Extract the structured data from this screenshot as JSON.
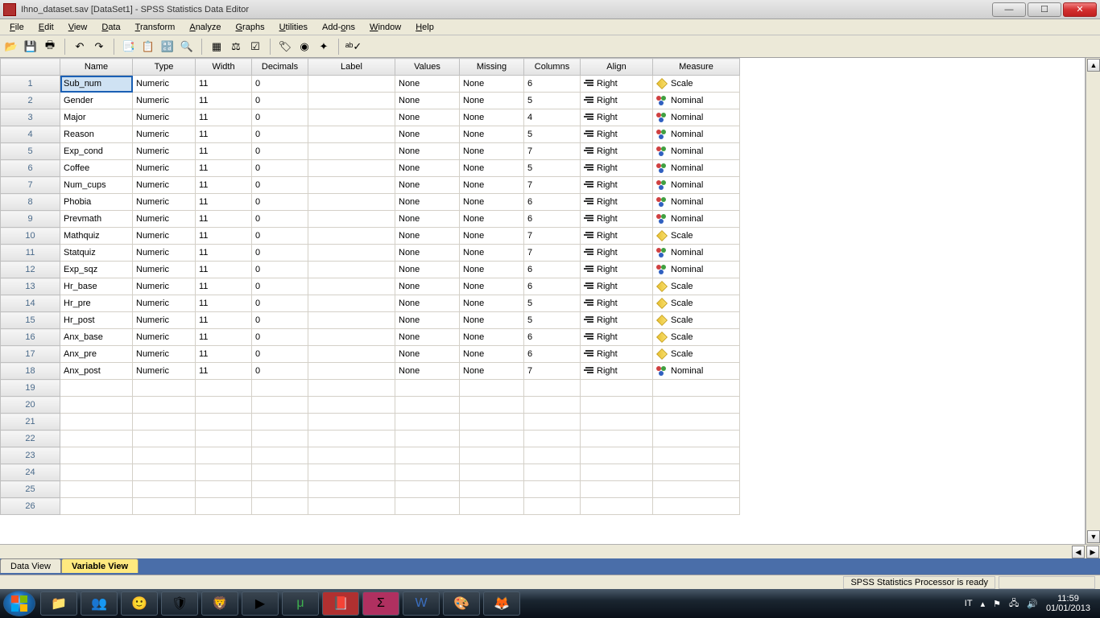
{
  "window": {
    "title": "Ihno_dataset.sav [DataSet1] - SPSS Statistics Data Editor"
  },
  "menus": [
    "File",
    "Edit",
    "View",
    "Data",
    "Transform",
    "Analyze",
    "Graphs",
    "Utilities",
    "Add-ons",
    "Window",
    "Help"
  ],
  "columns": [
    "Name",
    "Type",
    "Width",
    "Decimals",
    "Label",
    "Values",
    "Missing",
    "Columns",
    "Align",
    "Measure"
  ],
  "rows": [
    {
      "n": "1",
      "name": "Sub_num",
      "type": "Numeric",
      "width": "11",
      "dec": "0",
      "label": "",
      "values": "None",
      "missing": "None",
      "cols": "6",
      "align": "Right",
      "measure": "Scale"
    },
    {
      "n": "2",
      "name": "Gender",
      "type": "Numeric",
      "width": "11",
      "dec": "0",
      "label": "",
      "values": "None",
      "missing": "None",
      "cols": "5",
      "align": "Right",
      "measure": "Nominal"
    },
    {
      "n": "3",
      "name": "Major",
      "type": "Numeric",
      "width": "11",
      "dec": "0",
      "label": "",
      "values": "None",
      "missing": "None",
      "cols": "4",
      "align": "Right",
      "measure": "Nominal"
    },
    {
      "n": "4",
      "name": "Reason",
      "type": "Numeric",
      "width": "11",
      "dec": "0",
      "label": "",
      "values": "None",
      "missing": "None",
      "cols": "5",
      "align": "Right",
      "measure": "Nominal"
    },
    {
      "n": "5",
      "name": "Exp_cond",
      "type": "Numeric",
      "width": "11",
      "dec": "0",
      "label": "",
      "values": "None",
      "missing": "None",
      "cols": "7",
      "align": "Right",
      "measure": "Nominal"
    },
    {
      "n": "6",
      "name": "Coffee",
      "type": "Numeric",
      "width": "11",
      "dec": "0",
      "label": "",
      "values": "None",
      "missing": "None",
      "cols": "5",
      "align": "Right",
      "measure": "Nominal"
    },
    {
      "n": "7",
      "name": "Num_cups",
      "type": "Numeric",
      "width": "11",
      "dec": "0",
      "label": "",
      "values": "None",
      "missing": "None",
      "cols": "7",
      "align": "Right",
      "measure": "Nominal"
    },
    {
      "n": "8",
      "name": "Phobia",
      "type": "Numeric",
      "width": "11",
      "dec": "0",
      "label": "",
      "values": "None",
      "missing": "None",
      "cols": "6",
      "align": "Right",
      "measure": "Nominal"
    },
    {
      "n": "9",
      "name": "Prevmath",
      "type": "Numeric",
      "width": "11",
      "dec": "0",
      "label": "",
      "values": "None",
      "missing": "None",
      "cols": "6",
      "align": "Right",
      "measure": "Nominal"
    },
    {
      "n": "10",
      "name": "Mathquiz",
      "type": "Numeric",
      "width": "11",
      "dec": "0",
      "label": "",
      "values": "None",
      "missing": "None",
      "cols": "7",
      "align": "Right",
      "measure": "Scale"
    },
    {
      "n": "11",
      "name": "Statquiz",
      "type": "Numeric",
      "width": "11",
      "dec": "0",
      "label": "",
      "values": "None",
      "missing": "None",
      "cols": "7",
      "align": "Right",
      "measure": "Nominal"
    },
    {
      "n": "12",
      "name": "Exp_sqz",
      "type": "Numeric",
      "width": "11",
      "dec": "0",
      "label": "",
      "values": "None",
      "missing": "None",
      "cols": "6",
      "align": "Right",
      "measure": "Nominal"
    },
    {
      "n": "13",
      "name": "Hr_base",
      "type": "Numeric",
      "width": "11",
      "dec": "0",
      "label": "",
      "values": "None",
      "missing": "None",
      "cols": "6",
      "align": "Right",
      "measure": "Scale"
    },
    {
      "n": "14",
      "name": "Hr_pre",
      "type": "Numeric",
      "width": "11",
      "dec": "0",
      "label": "",
      "values": "None",
      "missing": "None",
      "cols": "5",
      "align": "Right",
      "measure": "Scale"
    },
    {
      "n": "15",
      "name": "Hr_post",
      "type": "Numeric",
      "width": "11",
      "dec": "0",
      "label": "",
      "values": "None",
      "missing": "None",
      "cols": "5",
      "align": "Right",
      "measure": "Scale"
    },
    {
      "n": "16",
      "name": "Anx_base",
      "type": "Numeric",
      "width": "11",
      "dec": "0",
      "label": "",
      "values": "None",
      "missing": "None",
      "cols": "6",
      "align": "Right",
      "measure": "Scale"
    },
    {
      "n": "17",
      "name": "Anx_pre",
      "type": "Numeric",
      "width": "11",
      "dec": "0",
      "label": "",
      "values": "None",
      "missing": "None",
      "cols": "6",
      "align": "Right",
      "measure": "Scale"
    },
    {
      "n": "18",
      "name": "Anx_post",
      "type": "Numeric",
      "width": "11",
      "dec": "0",
      "label": "",
      "values": "None",
      "missing": "None",
      "cols": "7",
      "align": "Right",
      "measure": "Nominal"
    }
  ],
  "empty_rows": [
    "19",
    "20",
    "21",
    "22",
    "23",
    "24",
    "25",
    "26"
  ],
  "tabs": {
    "data_view": "Data View",
    "variable_view": "Variable View"
  },
  "status": {
    "processor": "SPSS Statistics Processor is ready"
  },
  "systray": {
    "lang": "IT",
    "time": "11:59",
    "date": "01/01/2013"
  }
}
